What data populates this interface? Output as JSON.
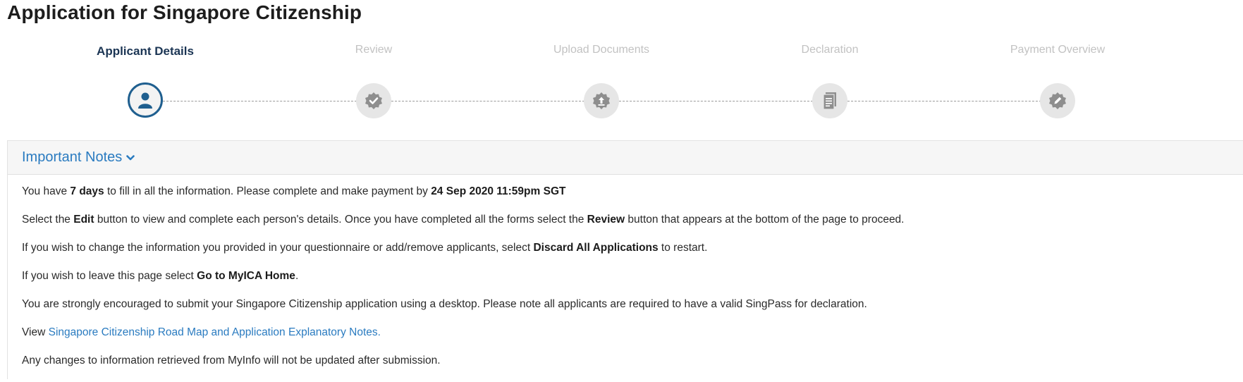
{
  "page": {
    "title": "Application for Singapore Citizenship"
  },
  "stepper": {
    "steps": [
      {
        "label": "Applicant Details",
        "icon": "user-icon",
        "state": "active"
      },
      {
        "label": "Review",
        "icon": "verified-badge-icon",
        "state": "inactive"
      },
      {
        "label": "Upload Documents",
        "icon": "upload-badge-icon",
        "state": "inactive"
      },
      {
        "label": "Declaration",
        "icon": "document-icon",
        "state": "inactive"
      },
      {
        "label": "Payment Overview",
        "icon": "edit-badge-icon",
        "state": "inactive"
      }
    ]
  },
  "notes": {
    "title": "Important Notes",
    "toggle_icon": "chevron-down-icon",
    "line1": {
      "t1": "You have ",
      "b1": "7 days",
      "t2": " to fill in all the information. Please complete and make payment by ",
      "b2": "24 Sep 2020 11:59pm SGT"
    },
    "line2": {
      "t1": "Select the ",
      "b1": "Edit",
      "t2": " button to view and complete each person's details. Once you have completed all the forms select the ",
      "b2": "Review",
      "t3": " button that appears at the bottom of the page to proceed."
    },
    "line3": {
      "t1": "If you wish to change the information you provided in your questionnaire or add/remove applicants, select ",
      "b1": "Discard All Applications",
      "t2": " to restart."
    },
    "line4": {
      "t1": "If you wish to leave this page select ",
      "b1": "Go to MyICA Home",
      "t2": "."
    },
    "line5": {
      "t1": "You are strongly encouraged to submit your Singapore Citizenship application using a desktop. Please note all applicants are required to have a valid SingPass for declaration."
    },
    "line6": {
      "t1": "View ",
      "link": "Singapore Citizenship Road Map and Application Explanatory Notes."
    },
    "line7": {
      "t1": "Any changes to information retrieved from MyInfo will not be updated after submission."
    }
  },
  "colors": {
    "accent_link": "#2a7bc0",
    "active_step": "#1f5f8f",
    "inactive_step_bg": "#e6e6e6",
    "inactive_icon": "#8e8e8e"
  }
}
